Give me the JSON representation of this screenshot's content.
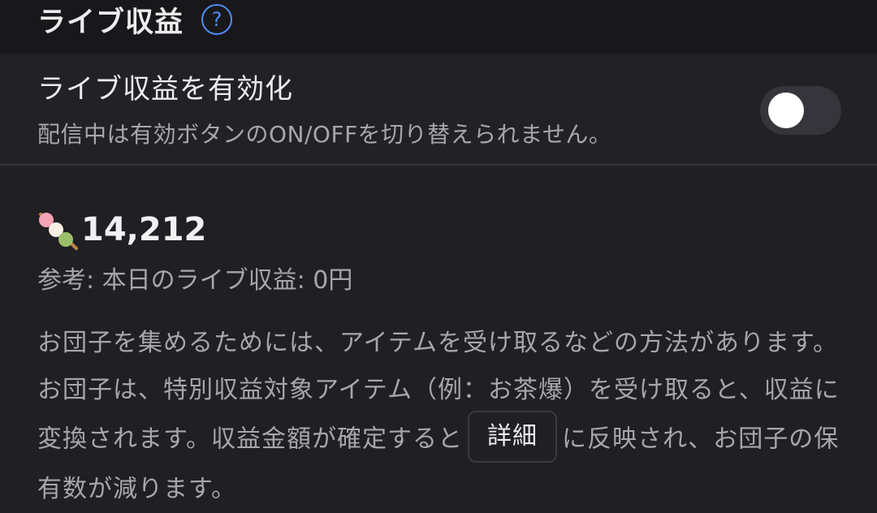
{
  "header": {
    "title": "ライブ収益",
    "help_icon": "question-circle-icon",
    "help_glyph": "?"
  },
  "enable": {
    "title": "ライブ収益を有効化",
    "description": "配信中は有効ボタンのON/OFFを切り替えられません。",
    "toggle_on": false
  },
  "balance": {
    "icon": "dango-icon",
    "amount": "14,212",
    "today": "参考: 本日のライブ収益: 0円"
  },
  "info": {
    "text_before": "お団子を集めるためには、アイテムを受け取るなどの方法があります。お団子は、特別収益対象アイテム（例：お茶爆）を受け取ると、収益に変換されます。収益金額が確定すると",
    "details_label": "詳細",
    "text_after": "に反映され、お団子の保有数が減ります。"
  },
  "colors": {
    "accent": "#4f8df5",
    "background": "#202024",
    "header_background": "#18181b"
  }
}
